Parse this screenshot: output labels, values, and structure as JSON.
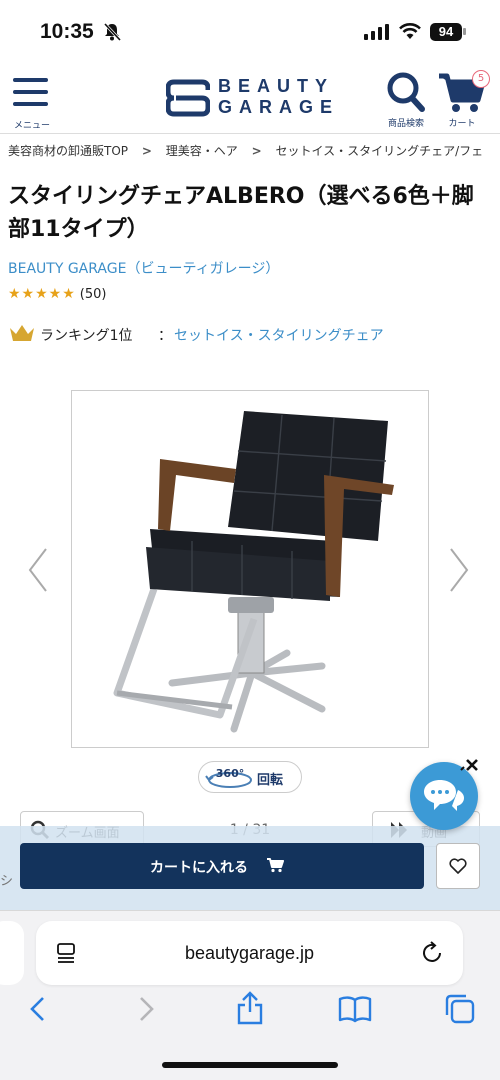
{
  "status_bar": {
    "time": "10:35",
    "battery": "94"
  },
  "header": {
    "menu_label": "メニュー",
    "logo_line1": "BEAUTY",
    "logo_line2": "GARAGE",
    "search_label": "商品検索",
    "cart_label": "カート",
    "cart_count": "5"
  },
  "breadcrumb": {
    "items": [
      "美容商材の卸通販TOP",
      "理美容・ヘア",
      "セットイス・スタイリングチェア/フェ"
    ],
    "separator": ">"
  },
  "product": {
    "title": "スタイリングチェアALBERO（選べる6色＋脚部11タイプ）",
    "brand": "BEAUTY GARAGE（ビューティガレージ）",
    "rating": 4.5,
    "stars": "★★★★★",
    "review_count": "(50)",
    "ranking_label": "ランキング1位",
    "ranking_colon": "：",
    "ranking_category": "セットイス・スタイリングチェア",
    "image_alt": "chair-photo"
  },
  "gallery": {
    "rotate_icon_text": "360°",
    "rotate_label": "回転",
    "zoom_label": "ズーム画面",
    "counter": "1 / 31",
    "video_label": "動画"
  },
  "purchase": {
    "add_to_cart": "カートに入れる",
    "edge_text": "シ"
  },
  "browser": {
    "url": "beautygarage.jp"
  },
  "colors": {
    "navy": "#13335c",
    "link_blue": "#3c8ec8",
    "star": "#e7a21a",
    "chat": "#3c9ad6"
  }
}
